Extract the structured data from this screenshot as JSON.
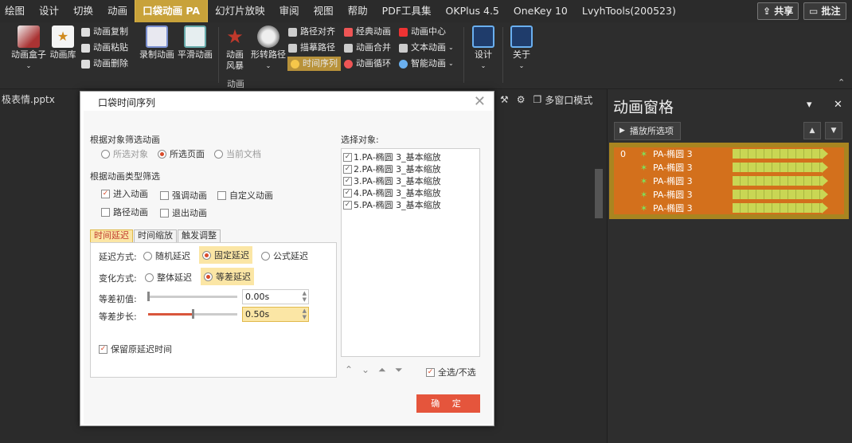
{
  "menu": {
    "items": [
      "绘图",
      "设计",
      "切换",
      "动画",
      "口袋动画 PA",
      "幻灯片放映",
      "审阅",
      "视图",
      "帮助",
      "PDF工具集",
      "OKPlus 4.5",
      "OneKey 10",
      "LvyhTools(200523)"
    ],
    "active_index": 4,
    "share_label": "共享",
    "comment_label": "批注"
  },
  "ribbon": {
    "anim_box": "动画盒子",
    "anim_lib": "动画库",
    "anim_copy": "动画复制",
    "anim_paste": "动画粘贴",
    "anim_delete": "动画删除",
    "record_anim": "录制动画",
    "smooth_anim": "平滑动画",
    "anim_storm_1": "动画",
    "anim_storm_2": "风暴",
    "morph_path": "形转路径",
    "path_align": "路径对齐",
    "trace_path": "描摹路径",
    "time_sequence": "时间序列",
    "classic_anim": "经典动画",
    "anim_merge": "动画合并",
    "anim_loop": "动画循环",
    "anim_center": "动画中心",
    "text_anim": "文本动画",
    "smart_anim": "智能动画",
    "group_label": "动画",
    "design": "设计",
    "about": "关于"
  },
  "doc": {
    "filename": "极表情.pptx",
    "multi_window": "多窗口模式"
  },
  "pane": {
    "title": "动画窗格",
    "play_selected": "播放所选项",
    "list": [
      {
        "num": "0",
        "name": "PA-椭圆 3"
      },
      {
        "num": "",
        "name": "PA-椭圆 3"
      },
      {
        "num": "",
        "name": "PA-椭圆 3"
      },
      {
        "num": "",
        "name": "PA-椭圆 3"
      },
      {
        "num": "",
        "name": "PA-椭圆 3"
      }
    ]
  },
  "dialog": {
    "title": "口袋时间序列",
    "filter_by_object": "根据对象筛选动画",
    "opt_selected_obj": "所选对象",
    "opt_selected_page": "所选页面",
    "opt_current_doc": "当前文档",
    "filter_by_type": "根据动画类型筛选",
    "type_entrance": "进入动画",
    "type_emphasis": "强调动画",
    "type_custom": "自定义动画",
    "type_path": "路径动画",
    "type_exit": "退出动画",
    "tab_delay": "时间延迟",
    "tab_scale": "时间缩放",
    "tab_trigger": "触发调整",
    "delay_mode_label": "延迟方式:",
    "delay_random": "随机延迟",
    "delay_fixed": "固定延迟",
    "delay_formula": "公式延迟",
    "change_mode_label": "变化方式:",
    "change_whole": "整体延迟",
    "change_arith": "等差延迟",
    "init_label": "等差初值:",
    "init_value": "0.00s",
    "step_label": "等差步长:",
    "step_value": "0.50s",
    "keep_delay": "保留原延迟时间",
    "select_obj_label": "选择对象:",
    "objects": [
      "1.PA-椭圆 3_基本缩放",
      "2.PA-椭圆 3_基本缩放",
      "3.PA-椭圆 3_基本缩放",
      "4.PA-椭圆 3_基本缩放",
      "5.PA-椭圆 3_基本缩放"
    ],
    "select_all": "全选/不选",
    "ok": "确 定"
  },
  "colors": {
    "accent": "#c8a23a",
    "pane_list_bg": "#d3701c",
    "ok_button": "#e5553c",
    "highlight": "#fbe6a5"
  }
}
